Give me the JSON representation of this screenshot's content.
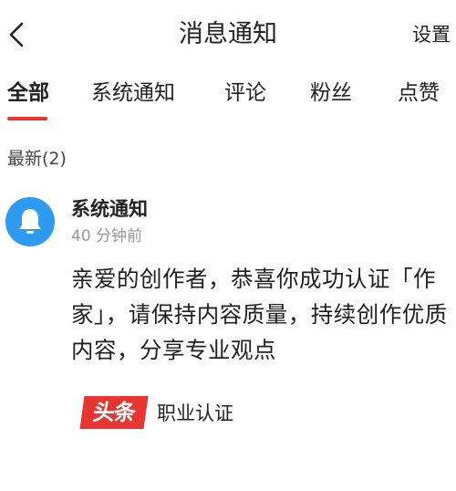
{
  "header": {
    "title": "消息通知",
    "settings_label": "设置"
  },
  "tabs": [
    {
      "label": "全部",
      "active": true
    },
    {
      "label": "系统通知",
      "active": false
    },
    {
      "label": "评论",
      "active": false
    },
    {
      "label": "粉丝",
      "active": false
    },
    {
      "label": "点赞",
      "active": false
    }
  ],
  "section": {
    "label": "最新(2)"
  },
  "notification": {
    "sender": "系统通知",
    "time": "40 分钟前",
    "message": "亲爱的创作者，恭喜你成功认证「作家」，请保持内容质量，持续创作优质内容，分享专业观点",
    "brand_logo_text": "头条",
    "certification_label": "职业认证",
    "avatar_color": "#2e9bf0",
    "brand_color": "#e8352f"
  },
  "colors": {
    "accent": "#e8352f"
  }
}
